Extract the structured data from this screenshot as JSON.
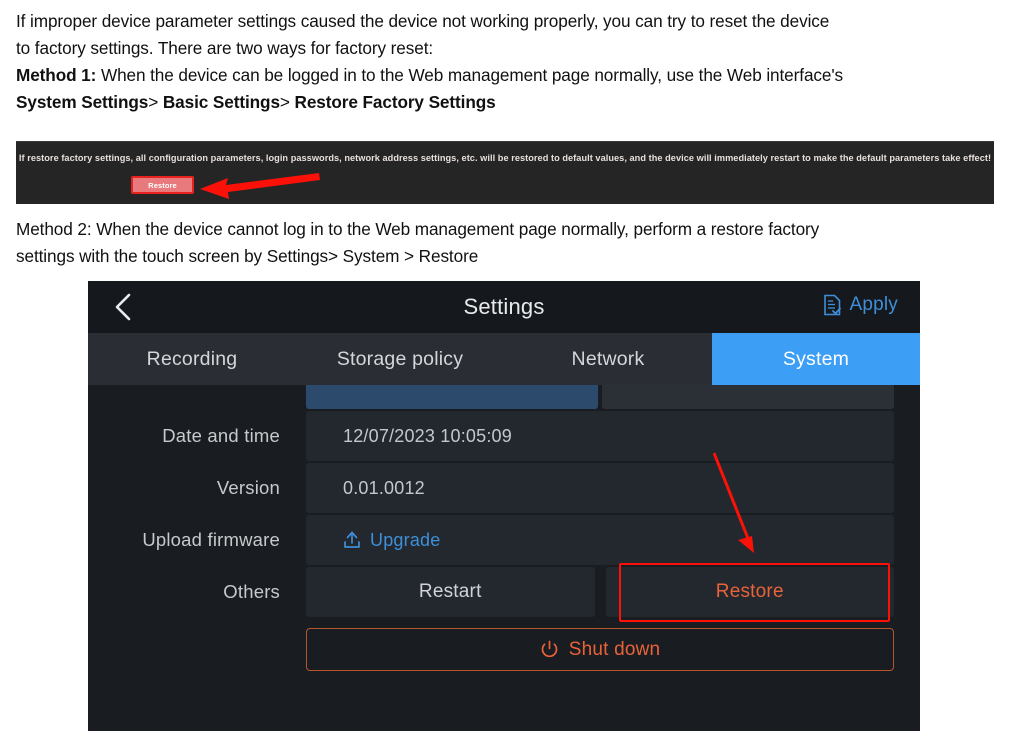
{
  "document": {
    "paragraph1_line1": "If improper device parameter settings caused the device not working properly, you can try to reset the device",
    "paragraph1_line2": "to factory settings. There are two ways for factory reset:",
    "method1_label": "Method 1:",
    "method1_text": " When the device can be logged in to the Web management page normally, use the Web interface's",
    "method1_path_a": "System Settings",
    "method1_sep_a": "> ",
    "method1_path_b": "Basic Settings",
    "method1_sep_b": "> ",
    "method1_path_c": "Restore Factory Settings",
    "method2_label": "Method 2:",
    "method2_text": " When the device cannot log in to the Web management page normally, perform a restore factory",
    "method2_line2_pre": "settings with the touch screen by ",
    "method2_path_a": "Settings",
    "method2_sep_a": "> ",
    "method2_path_b": "System",
    "method2_sep_b": " > ",
    "method2_path_c": "Restore"
  },
  "web_banner": {
    "warning_text": "If restore factory settings, all configuration parameters, login passwords, network address settings, etc. will be restored to default values, and the device will immediately restart to make the default parameters take effect!",
    "restore_button_label": "Restore",
    "restore_button_bg": "#e87a7e",
    "restore_button_border": "#e8221f",
    "banner_bg": "#252525"
  },
  "annotations": {
    "arrow_color": "#fc1108",
    "highlight_color": "#fc1108"
  },
  "touch_ui": {
    "header": {
      "back_icon": "chevron-left-icon",
      "title": "Settings",
      "apply_icon": "document-check-icon",
      "apply_label": "Apply",
      "apply_color": "#3f8fd8"
    },
    "tabs": [
      {
        "label": "Recording",
        "active": false
      },
      {
        "label": "Storage policy",
        "active": false
      },
      {
        "label": "Network",
        "active": false
      },
      {
        "label": "System",
        "active": true
      }
    ],
    "active_tab_color": "#3d9ef5",
    "rows": [
      {
        "label": "Date and time",
        "value": "12/07/2023 10:05:09"
      },
      {
        "label": "Version",
        "value": "0.01.0012"
      }
    ],
    "upload_row": {
      "label": "Upload firmware",
      "icon": "upload-icon",
      "value": "Upgrade"
    },
    "others_row": {
      "label": "Others",
      "restart_label": "Restart",
      "restore_label": "Restore",
      "restore_color": "#e8633a"
    },
    "shutdown": {
      "icon": "power-icon",
      "label": "Shut down",
      "color": "#e8633a"
    }
  }
}
